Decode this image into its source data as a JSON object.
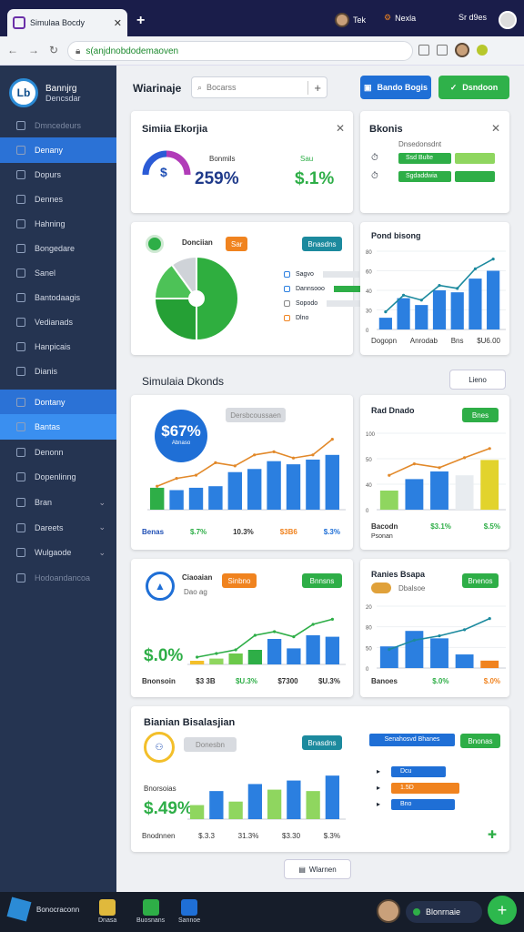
{
  "browser": {
    "tab_title": "Simulaa Bocdy",
    "addr_url": "s(anjdnobdodemaoven",
    "right": [
      {
        "label": "Tek"
      },
      {
        "label": "Nexla"
      },
      {
        "label": "Sr d9es"
      }
    ]
  },
  "sidebar": {
    "brand_line1": "Bannjrg",
    "brand_line2": "Dencsdar",
    "items": [
      {
        "label": "Dmncedeurs",
        "state": "dim"
      },
      {
        "label": "Denany",
        "state": "active"
      },
      {
        "label": "Dopurs",
        "state": "normal"
      },
      {
        "label": "Dennes",
        "state": "normal"
      },
      {
        "label": "Hahning",
        "state": "normal"
      },
      {
        "label": "Bongedare",
        "state": "normal"
      },
      {
        "label": "Sanel",
        "state": "normal"
      },
      {
        "label": "Bantodaagis",
        "state": "normal"
      },
      {
        "label": "Vedianads",
        "state": "normal"
      },
      {
        "label": "Hanpicais",
        "state": "normal"
      },
      {
        "label": "Dianis",
        "state": "normal"
      },
      {
        "label": "Dontany",
        "state": "active"
      },
      {
        "label": "Bantas",
        "state": "active2"
      },
      {
        "label": "Denonn",
        "state": "normal"
      },
      {
        "label": "Dopenlinng",
        "state": "normal"
      },
      {
        "label": "Bran",
        "state": "normal",
        "chevron": true
      },
      {
        "label": "Dareets",
        "state": "normal",
        "chevron": true
      },
      {
        "label": "Wulgaode",
        "state": "normal",
        "chevron": true
      },
      {
        "label": "Hodoandancoa",
        "state": "dim"
      }
    ]
  },
  "header": {
    "title": "Wiarinaje",
    "search_placeholder": "Bocarss",
    "btn1": "Bando Bogis",
    "btn2": "Dsndoon"
  },
  "card1": {
    "title": "Simiia Ekorjia",
    "kpi_label": "Bonmils",
    "kpi_value": "259%",
    "kpi2_label": "Sau",
    "kpi2_value": "$.1%"
  },
  "card2": {
    "title": "Bkonis",
    "header_label": "Dnsedonsdnt",
    "rows": [
      {
        "label": "Ssd Bulte",
        "pct": 0.7
      },
      {
        "label": "Sgdaddwia",
        "pct": 0.55
      }
    ]
  },
  "card3": {
    "label": "Donciian",
    "badge": "Sar",
    "action": "Bnasdns",
    "legend": [
      {
        "label": "Sagvo"
      },
      {
        "label": "Dannsooo"
      },
      {
        "label": "Sopodo"
      },
      {
        "label": "Dlno"
      }
    ]
  },
  "card4": {
    "title": "Pond bisong",
    "foot": [
      "Dogopn",
      "Anrodab",
      "Bns",
      "$U6.00"
    ]
  },
  "section2": {
    "title": "Simulaia Dkonds",
    "button": "Lieno"
  },
  "card5": {
    "kpi": "$67%",
    "kpi_sub": "Abnaso",
    "filter": "Dersbcoussaen",
    "foot": [
      "Benas",
      "$.7%",
      "10.3%",
      "$3B6",
      "$.3%"
    ]
  },
  "card6": {
    "title": "Rad Dnado",
    "action": "Bnes",
    "foot": [
      "Bacodn",
      "$3.1%",
      "$.5%"
    ],
    "foot2": "Psonan"
  },
  "card7": {
    "label": "Ciaoaian",
    "badge": "Sinbno",
    "sub": "Dao ag",
    "action": "Bnnsns",
    "kpi": "$.0%",
    "foot": [
      "Bnonsoin",
      "$3 3B",
      "$U.3%",
      "$7300",
      "$U.3%"
    ]
  },
  "card8": {
    "title": "Ranies Bsapa",
    "sub": "Dbalsoe",
    "action": "Bnenos",
    "foot": [
      "Banoes",
      "$.0%",
      "$.0%"
    ]
  },
  "card9": {
    "title": "Bianian Bisalasjian",
    "pill": "Donesbn",
    "action": "Bnasdns",
    "kpi": "$.49%",
    "sub": "Bnorsoias",
    "foot": [
      "Bnodnnen",
      "$.3.3",
      "31.3%",
      "$3.30",
      "$.3%"
    ]
  },
  "card10": {
    "hdr": "Senahosvd Bhanes",
    "rows": [
      {
        "label": "Dcu",
        "pct": 0.6
      },
      {
        "label": "1.5D",
        "pct": 0.75
      },
      {
        "label": "Bno",
        "pct": 0.7
      }
    ],
    "action": "Bnonas"
  },
  "more_button": "Wlarnen",
  "taskbar": {
    "start": "Bonocraconn",
    "items": [
      "Dnasa",
      "Buosnans",
      "Sannoe"
    ],
    "right_label": "Blonrnaie"
  },
  "chart_data": [
    {
      "type": "pie",
      "title": "Donciian",
      "values": [
        50,
        25,
        15,
        10
      ],
      "colors": [
        "#2fae3f",
        "#25a035",
        "#4dc257",
        "#cfd3d8"
      ]
    },
    {
      "type": "bar",
      "title": "Pond bisong",
      "categories": [
        "1",
        "2",
        "3",
        "4",
        "5",
        "6",
        "7"
      ],
      "values": [
        12,
        32,
        25,
        40,
        38,
        52,
        60
      ],
      "yticks": [
        "0",
        "30",
        "40",
        "60",
        "80"
      ],
      "line": [
        18,
        35,
        30,
        45,
        42,
        62,
        72
      ]
    },
    {
      "type": "bar",
      "title": "Simulaia Dkonds",
      "values": [
        28,
        25,
        28,
        30,
        48,
        52,
        62,
        58,
        64,
        70
      ],
      "colors": [
        "#2eae47",
        "#2b7fe0",
        "#2b7fe0",
        "#2b7fe0",
        "#2b7fe0",
        "#2b7fe0",
        "#2b7fe0",
        "#2b7fe0",
        "#2b7fe0",
        "#2b7fe0"
      ],
      "line": [
        30,
        40,
        44,
        60,
        56,
        70,
        74,
        66,
        70,
        90
      ]
    },
    {
      "type": "bar",
      "title": "Rad Dnado",
      "values": [
        25,
        40,
        50,
        45,
        65
      ],
      "colors": [
        "#8fd65f",
        "#2b7fe0",
        "#2b7fe0",
        "#e8ecf0",
        "#e2d32c"
      ],
      "yticks": [
        "0",
        "40",
        "50",
        "100"
      ],
      "line": [
        45,
        60,
        55,
        68,
        80
      ]
    },
    {
      "type": "bar",
      "title": "Ciaoaian",
      "values": [
        5,
        8,
        15,
        20,
        35,
        22,
        40,
        38
      ],
      "colors": [
        "#f3bf2a",
        "#8fd65f",
        "#6bc94a",
        "#2eae47",
        "#2b7fe0",
        "#2b7fe0",
        "#2b7fe0",
        "#2b7fe0"
      ],
      "line": [
        10,
        15,
        20,
        40,
        45,
        38,
        55,
        62
      ]
    },
    {
      "type": "bar",
      "title": "Ranies Bsapa",
      "values": [
        35,
        60,
        48,
        22,
        12
      ],
      "colors": [
        "#2b7fe0",
        "#2b7fe0",
        "#2b7fe0",
        "#2b7fe0",
        "#f0831f"
      ],
      "yticks": [
        "0",
        "50",
        "80",
        "20"
      ],
      "line": [
        30,
        45,
        52,
        62,
        80
      ]
    },
    {
      "type": "bar",
      "title": "Bianian Bisalasjian",
      "values": [
        20,
        40,
        25,
        50,
        42,
        55,
        40,
        62
      ],
      "colors": [
        "#8fd65f",
        "#2b7fe0",
        "#8fd65f",
        "#2b7fe0",
        "#8fd65f",
        "#2b7fe0",
        "#8fd65f",
        "#2b7fe0"
      ]
    }
  ]
}
